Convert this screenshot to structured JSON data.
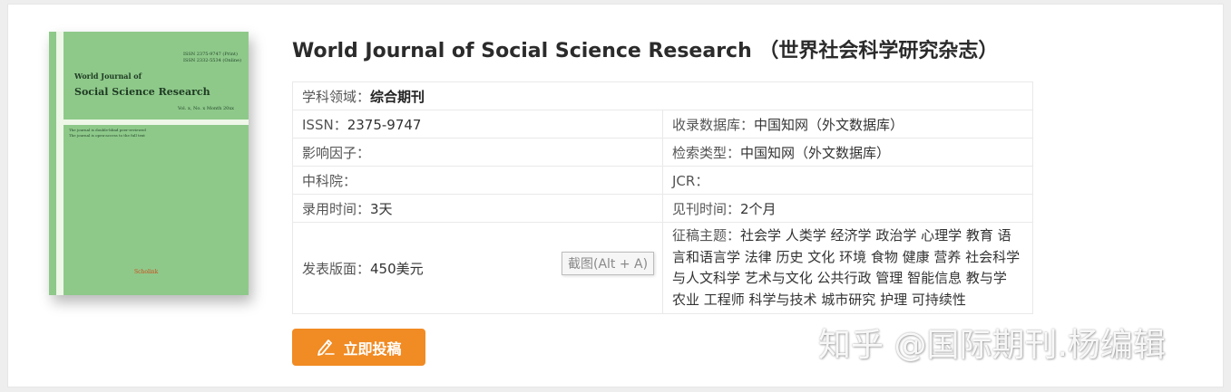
{
  "cover": {
    "issn_lines": [
      "ISSN 2375-9747 (Print)",
      "ISSN 2332-5534 (Online)"
    ],
    "small_title": "World Journal of",
    "big_title": "Social Science Research",
    "vol": "Vol. x, No. x Month 20xx",
    "note_lines": [
      "The journal is double-blind peer-reviewed",
      "The journal is open-access to the full text"
    ],
    "publisher": "Scholink"
  },
  "journal": {
    "title": "World Journal of Social Science Research （世界社会科学研究杂志）"
  },
  "info": {
    "field_label": "学科领域：",
    "field_value": "综合期刊",
    "issn_label": "ISSN：",
    "issn_value": "2375-9747",
    "db_label": "收录数据库：",
    "db_value": "中国知网（外文数据库）",
    "impact_label": "影响因子：",
    "search_label": "检索类型：",
    "search_value": "中国知网（外文数据库）",
    "cas_label": "中科院：",
    "jcr_label": "JCR：",
    "accept_label": "录用时间：",
    "accept_value": "3天",
    "pub_label": "见刊时间：",
    "pub_value": "2个月",
    "price_label": "发表版面：",
    "price_value": "450美元",
    "topics_label": "征稿主题：",
    "topics_value": "社会学 人类学 经济学 政治学 心理学 教育 语言和语言学 法律 历史 文化 环境 食物 健康 营养 社会科学与人文科学 艺术与文化 公共行政 管理 智能信息 教与学 农业 工程师 科学与技术 城市研究 护理 可持续性"
  },
  "tooltip": "截图(Alt + A)",
  "submit_label": "立即投稿",
  "watermark": "知乎 @国际期刊.杨编辑",
  "colors": {
    "button": "#f18b23",
    "cover_green": "#8ec98a"
  }
}
